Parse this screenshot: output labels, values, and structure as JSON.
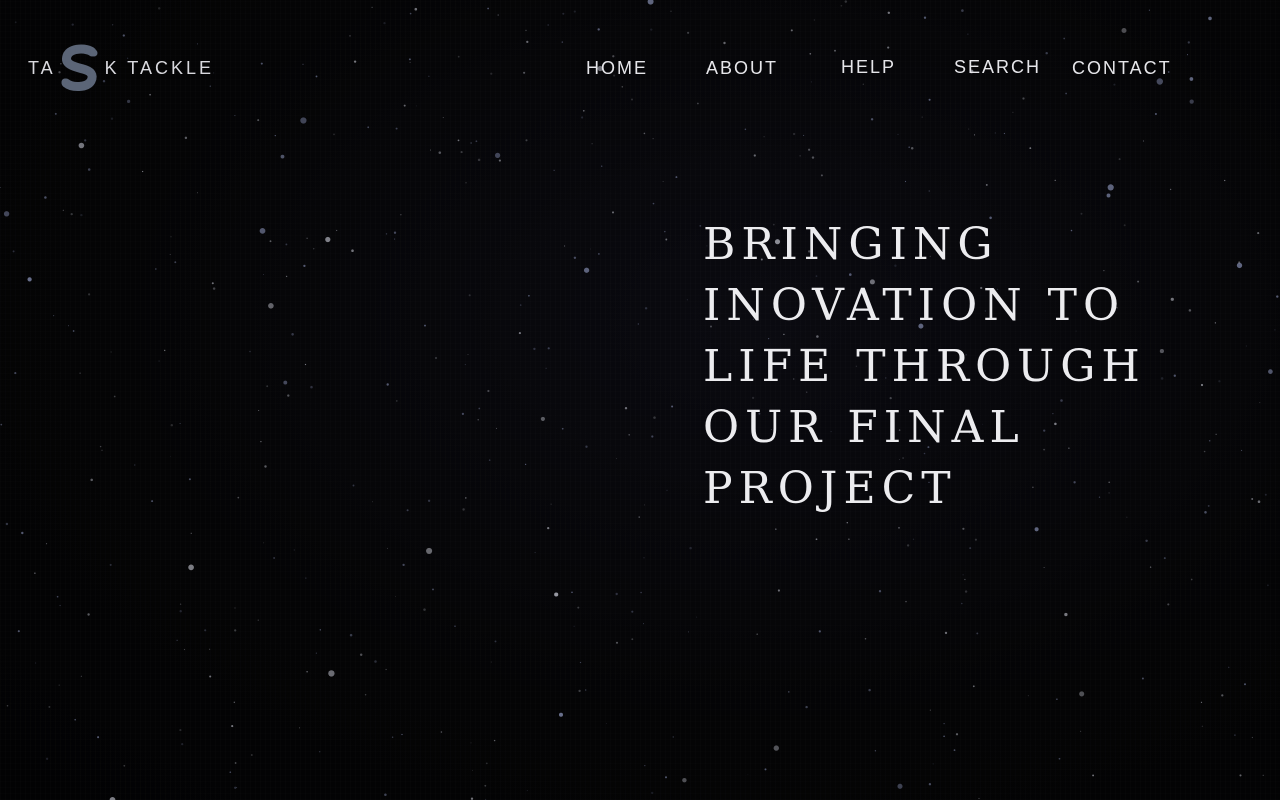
{
  "brand": {
    "name_before": "TA",
    "name_after": "K TACKLE",
    "logo_icon": "s-letter-logo-icon",
    "logo_color": "#5b6577"
  },
  "nav": {
    "items": [
      {
        "label": "HOME"
      },
      {
        "label": "ABOUT"
      },
      {
        "label": "HELP"
      },
      {
        "label": "SEARCH"
      },
      {
        "label": "CONTACT"
      }
    ]
  },
  "hero": {
    "lines": [
      "BRINGING",
      "INOVATION TO",
      "LIFE THROUGH",
      "OUR FINAL",
      "PROJECT"
    ]
  },
  "colors": {
    "background": "#030304",
    "text": "#e6e6ea",
    "star_tint": "#8a93b8"
  }
}
